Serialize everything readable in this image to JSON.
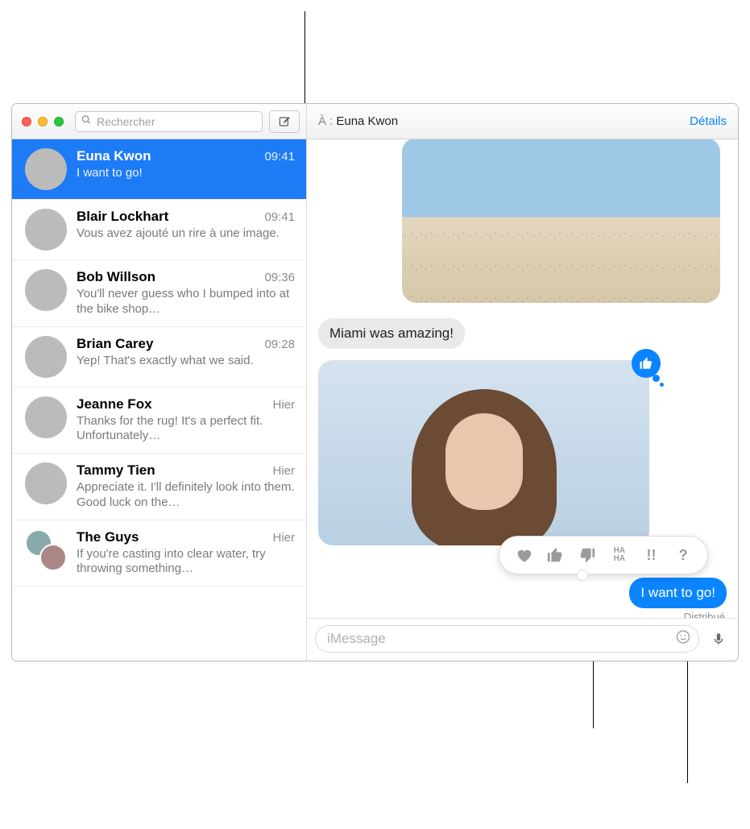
{
  "toolbar": {
    "search_placeholder": "Rechercher"
  },
  "header": {
    "to_label": "À : ",
    "to_name": "Euna Kwon",
    "details": "Détails"
  },
  "sidebar": {
    "items": [
      {
        "name": "Euna Kwon",
        "time": "09:41",
        "preview": "I want to go!"
      },
      {
        "name": "Blair Lockhart",
        "time": "09:41",
        "preview": "Vous avez ajouté un rire à une image."
      },
      {
        "name": "Bob Willson",
        "time": "09:36",
        "preview": "You'll never guess who I bumped into at the bike shop…"
      },
      {
        "name": "Brian Carey",
        "time": "09:28",
        "preview": "Yep! That's exactly what we said."
      },
      {
        "name": "Jeanne Fox",
        "time": "Hier",
        "preview": "Thanks for the rug! It's a perfect fit. Unfortunately…"
      },
      {
        "name": "Tammy Tien",
        "time": "Hier",
        "preview": "Appreciate it. I'll definitely look into them. Good luck on the…"
      },
      {
        "name": "The Guys",
        "time": "Hier",
        "preview": "If you're casting into clear water, try throwing something…"
      }
    ]
  },
  "thread": {
    "incoming_text": "Miami was amazing!",
    "sent_text": "I want to go!",
    "status": "Distribué"
  },
  "composer": {
    "placeholder": "iMessage"
  },
  "tapback": {
    "options": [
      "heart",
      "thumbs-up",
      "thumbs-down",
      "haha",
      "exclaim",
      "question"
    ],
    "haha_label": "HA HA",
    "exclaim_label": "!!",
    "question_label": "?"
  }
}
